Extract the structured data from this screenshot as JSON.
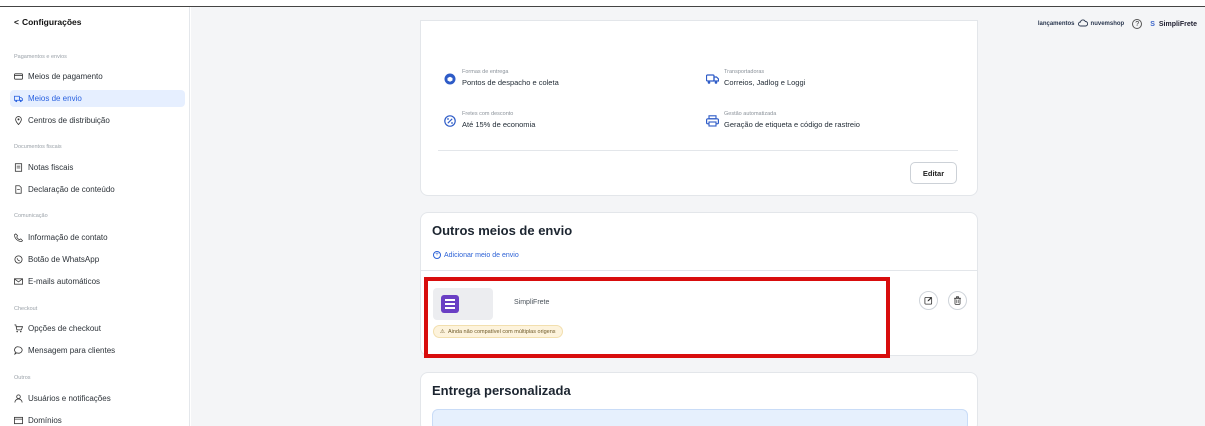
{
  "sidebar": {
    "back_label": "Configurações",
    "sections": [
      {
        "label": "Pagamentos e envios"
      },
      {
        "label": "Documentos fiscais"
      },
      {
        "label": "Comunicação"
      },
      {
        "label": "Checkout"
      },
      {
        "label": "Outros"
      }
    ],
    "items": [
      {
        "label": "Meios de pagamento",
        "icon": "card-icon"
      },
      {
        "label": "Meios de envio",
        "icon": "truck-icon",
        "active": true
      },
      {
        "label": "Centros de distribuição",
        "icon": "location-pin-icon"
      },
      {
        "label": "Notas fiscais",
        "icon": "document-icon"
      },
      {
        "label": "Declaração de conteúdo",
        "icon": "file-icon"
      },
      {
        "label": "Informação de contato",
        "icon": "phone-icon"
      },
      {
        "label": "Botão de WhatsApp",
        "icon": "whatsapp-icon"
      },
      {
        "label": "E-mails automáticos",
        "icon": "mail-icon"
      },
      {
        "label": "Opções de checkout",
        "icon": "cart-icon"
      },
      {
        "label": "Mensagem para clientes",
        "icon": "chat-icon"
      },
      {
        "label": "Usuários e notificações",
        "icon": "user-icon"
      },
      {
        "label": "Domínios",
        "icon": "browser-icon"
      }
    ]
  },
  "header": {
    "brand_prefix": "lançamentos",
    "brand_name": "nuvemshop",
    "help_symbol": "?",
    "user_initial": "S",
    "user_name": "SimpliFrete"
  },
  "card_features": {
    "features": [
      {
        "label": "Formas de entrega",
        "value": "Pontos de despacho e coleta",
        "icon": "box-icon"
      },
      {
        "label": "Transportadoras",
        "value": "Correios, Jadlog e Loggi",
        "icon": "truck-icon"
      },
      {
        "label": "Fretes com desconto",
        "value": "Até 15% de economia",
        "icon": "discount-icon"
      },
      {
        "label": "Gestão automatizada",
        "value": "Geração de etiqueta e código de rastreio",
        "icon": "printer-icon"
      }
    ],
    "edit_label": "Editar"
  },
  "outros_meios": {
    "title": "Outros meios de envio",
    "add_label": "Adicionar meio de envio",
    "service": {
      "name": "SimpliFrete",
      "warning": "Ainda não compatível com múltiplas origens"
    }
  },
  "entrega_personalizada": {
    "title": "Entrega personalizada"
  },
  "colors": {
    "accent": "#2d62d6",
    "highlight": "#d80d0d",
    "logo": "#6a3fc4",
    "warning_bg": "#fdf3dc"
  }
}
